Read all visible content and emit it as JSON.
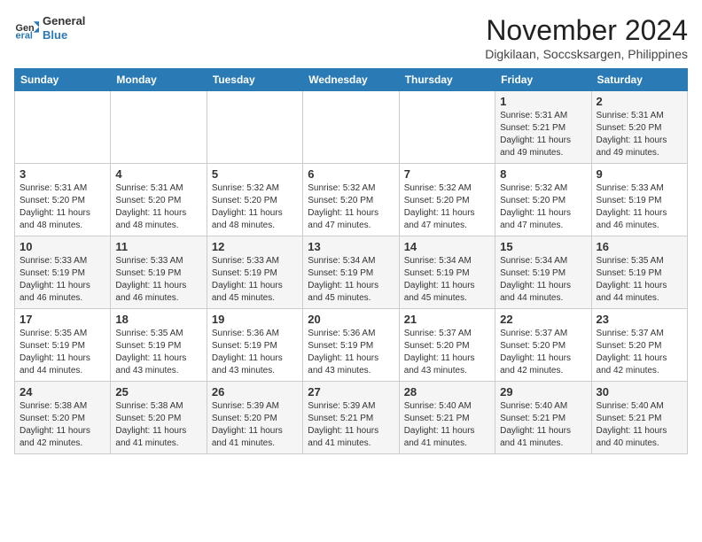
{
  "header": {
    "logo_line1": "General",
    "logo_line2": "Blue",
    "month_title": "November 2024",
    "location": "Digkilaan, Soccsksargen, Philippines"
  },
  "weekdays": [
    "Sunday",
    "Monday",
    "Tuesday",
    "Wednesday",
    "Thursday",
    "Friday",
    "Saturday"
  ],
  "weeks": [
    [
      {
        "day": "",
        "info": ""
      },
      {
        "day": "",
        "info": ""
      },
      {
        "day": "",
        "info": ""
      },
      {
        "day": "",
        "info": ""
      },
      {
        "day": "",
        "info": ""
      },
      {
        "day": "1",
        "info": "Sunrise: 5:31 AM\nSunset: 5:21 PM\nDaylight: 11 hours and 49 minutes."
      },
      {
        "day": "2",
        "info": "Sunrise: 5:31 AM\nSunset: 5:20 PM\nDaylight: 11 hours and 49 minutes."
      }
    ],
    [
      {
        "day": "3",
        "info": "Sunrise: 5:31 AM\nSunset: 5:20 PM\nDaylight: 11 hours and 48 minutes."
      },
      {
        "day": "4",
        "info": "Sunrise: 5:31 AM\nSunset: 5:20 PM\nDaylight: 11 hours and 48 minutes."
      },
      {
        "day": "5",
        "info": "Sunrise: 5:32 AM\nSunset: 5:20 PM\nDaylight: 11 hours and 48 minutes."
      },
      {
        "day": "6",
        "info": "Sunrise: 5:32 AM\nSunset: 5:20 PM\nDaylight: 11 hours and 47 minutes."
      },
      {
        "day": "7",
        "info": "Sunrise: 5:32 AM\nSunset: 5:20 PM\nDaylight: 11 hours and 47 minutes."
      },
      {
        "day": "8",
        "info": "Sunrise: 5:32 AM\nSunset: 5:20 PM\nDaylight: 11 hours and 47 minutes."
      },
      {
        "day": "9",
        "info": "Sunrise: 5:33 AM\nSunset: 5:19 PM\nDaylight: 11 hours and 46 minutes."
      }
    ],
    [
      {
        "day": "10",
        "info": "Sunrise: 5:33 AM\nSunset: 5:19 PM\nDaylight: 11 hours and 46 minutes."
      },
      {
        "day": "11",
        "info": "Sunrise: 5:33 AM\nSunset: 5:19 PM\nDaylight: 11 hours and 46 minutes."
      },
      {
        "day": "12",
        "info": "Sunrise: 5:33 AM\nSunset: 5:19 PM\nDaylight: 11 hours and 45 minutes."
      },
      {
        "day": "13",
        "info": "Sunrise: 5:34 AM\nSunset: 5:19 PM\nDaylight: 11 hours and 45 minutes."
      },
      {
        "day": "14",
        "info": "Sunrise: 5:34 AM\nSunset: 5:19 PM\nDaylight: 11 hours and 45 minutes."
      },
      {
        "day": "15",
        "info": "Sunrise: 5:34 AM\nSunset: 5:19 PM\nDaylight: 11 hours and 44 minutes."
      },
      {
        "day": "16",
        "info": "Sunrise: 5:35 AM\nSunset: 5:19 PM\nDaylight: 11 hours and 44 minutes."
      }
    ],
    [
      {
        "day": "17",
        "info": "Sunrise: 5:35 AM\nSunset: 5:19 PM\nDaylight: 11 hours and 44 minutes."
      },
      {
        "day": "18",
        "info": "Sunrise: 5:35 AM\nSunset: 5:19 PM\nDaylight: 11 hours and 43 minutes."
      },
      {
        "day": "19",
        "info": "Sunrise: 5:36 AM\nSunset: 5:19 PM\nDaylight: 11 hours and 43 minutes."
      },
      {
        "day": "20",
        "info": "Sunrise: 5:36 AM\nSunset: 5:19 PM\nDaylight: 11 hours and 43 minutes."
      },
      {
        "day": "21",
        "info": "Sunrise: 5:37 AM\nSunset: 5:20 PM\nDaylight: 11 hours and 43 minutes."
      },
      {
        "day": "22",
        "info": "Sunrise: 5:37 AM\nSunset: 5:20 PM\nDaylight: 11 hours and 42 minutes."
      },
      {
        "day": "23",
        "info": "Sunrise: 5:37 AM\nSunset: 5:20 PM\nDaylight: 11 hours and 42 minutes."
      }
    ],
    [
      {
        "day": "24",
        "info": "Sunrise: 5:38 AM\nSunset: 5:20 PM\nDaylight: 11 hours and 42 minutes."
      },
      {
        "day": "25",
        "info": "Sunrise: 5:38 AM\nSunset: 5:20 PM\nDaylight: 11 hours and 41 minutes."
      },
      {
        "day": "26",
        "info": "Sunrise: 5:39 AM\nSunset: 5:20 PM\nDaylight: 11 hours and 41 minutes."
      },
      {
        "day": "27",
        "info": "Sunrise: 5:39 AM\nSunset: 5:21 PM\nDaylight: 11 hours and 41 minutes."
      },
      {
        "day": "28",
        "info": "Sunrise: 5:40 AM\nSunset: 5:21 PM\nDaylight: 11 hours and 41 minutes."
      },
      {
        "day": "29",
        "info": "Sunrise: 5:40 AM\nSunset: 5:21 PM\nDaylight: 11 hours and 41 minutes."
      },
      {
        "day": "30",
        "info": "Sunrise: 5:40 AM\nSunset: 5:21 PM\nDaylight: 11 hours and 40 minutes."
      }
    ]
  ]
}
